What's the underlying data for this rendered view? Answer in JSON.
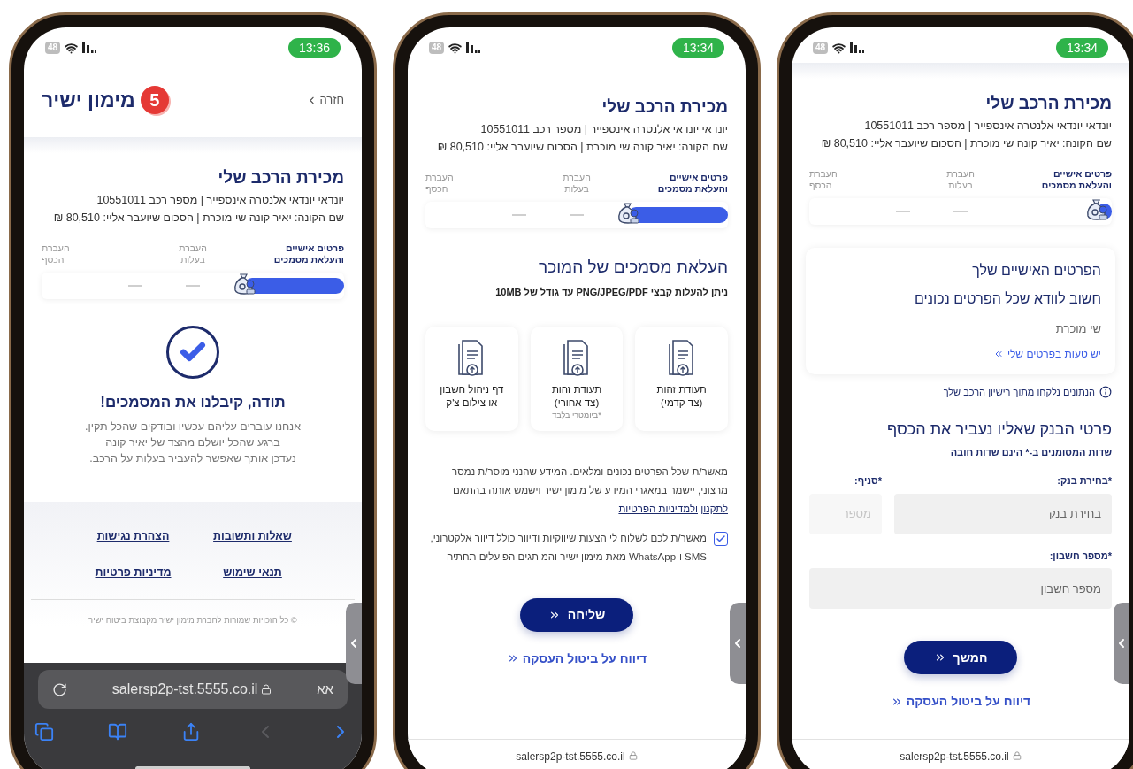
{
  "phones": [
    {
      "status": {
        "battery": "48",
        "time": "13:34"
      },
      "sections": [
        {
          "kind": "band"
        },
        {
          "kind": "summary",
          "title": "מכירת הרכב שלי",
          "lines": [
            "יונדאי יונדאי אלנטרה אינספייר | מספר רכב 10551011",
            "שם הקונה: יאיר קונה שי מוכרת | הסכום שיועבר אליי: 80,510 ₪"
          ]
        },
        {
          "kind": "stepper",
          "level": 0.05,
          "steps": [
            {
              "label": "פרטים אישיים\nוהעלאת מסמכים",
              "selected": true
            },
            {
              "label": "העברת\nבעלות",
              "selected": false
            },
            {
              "label": "העברת\nהכסף",
              "selected": false
            }
          ]
        },
        {
          "kind": "details",
          "heading": "הפרטים האישיים שלך",
          "subheading": "חשוב לוודא שכל הפרטים נכונים",
          "name": "שי מוכרת",
          "link": "יש טעות בפרטים שלי"
        },
        {
          "kind": "info",
          "text": "הנתונים נלקחו מתוך רישיון הרכב שלך"
        },
        {
          "kind": "bank_form",
          "title": "פרטי הבנק שאליו נעביר את הכסף",
          "note": "שדות המסומנים ב-* הינם שדות חובה",
          "rows": [
            {
              "fields": [
                {
                  "kind": "main",
                  "label": "*בחירת בנק:",
                  "placeholder": "בחירת בנק",
                  "disabled": false
                },
                {
                  "kind": "narrow",
                  "label": "*סניף:",
                  "placeholder": "מספר",
                  "disabled": true
                }
              ]
            },
            {
              "fields": [
                {
                  "kind": "main",
                  "label": "*מספר חשבון:",
                  "placeholder": "מספר חשבון",
                  "disabled": false
                }
              ]
            }
          ]
        },
        {
          "kind": "button",
          "label": "המשך"
        },
        {
          "kind": "link",
          "label": "דיווח על ביטול העסקה"
        }
      ],
      "browser": {
        "kind": "compact",
        "url": "salersp2p-tst.5555.co.il"
      }
    },
    {
      "status": {
        "battery": "48",
        "time": "13:34"
      },
      "sections": [
        {
          "kind": "spacer"
        },
        {
          "kind": "summary",
          "title": "מכירת הרכב שלי",
          "lines": [
            "יונדאי יונדאי אלנטרה אינספייר | מספר רכב 10551011",
            "שם הקונה: יאיר קונה שי מוכרת | הסכום שיועבר אליי: 80,510 ₪"
          ]
        },
        {
          "kind": "stepper",
          "level": 0.33,
          "steps": [
            {
              "label": "פרטים אישיים\nוהעלאת מסמכים",
              "selected": true
            },
            {
              "label": "העברת\nבעלות",
              "selected": false
            },
            {
              "label": "העברת\nהכסף",
              "selected": false
            }
          ]
        },
        {
          "kind": "upload",
          "title": "העלאת מסמכים של המוכר",
          "note": "ניתן להעלות קבצי PNG/JPEG/PDF עד גודל של 10MB",
          "cards": [
            {
              "label": "תעודת זהות\n(צד קדמי)"
            },
            {
              "label": "תעודת זהות\n(צד אחורי)",
              "note": "*ביומטרי בלבד"
            },
            {
              "label": "דף ניהול חשבון\nאו צילום צ'ק"
            }
          ]
        },
        {
          "kind": "consent",
          "text": "מאשר/ת שכל הפרטים נכונים ומלאים. המידע שהנני מוסר/ת נמסר מרצוני, יישמר במאגרי המידע של מימון ישיר וישמש אותה בהתאם",
          "links": [
            "לתקנון",
            "ולמדיניות הפרטיות"
          ],
          "checkbox": {
            "checked": true,
            "label": "מאשר/ת לכם לשלוח לי הצעות שיווקיות ודיוור כולל דיוור אלקטרוני, SMS ו-WhatsApp מאת מימון ישיר והמותגים הפועלים תחתיה"
          }
        },
        {
          "kind": "button",
          "label": "שליחה"
        },
        {
          "kind": "link",
          "label": "דיווח על ביטול העסקה"
        }
      ],
      "browser": {
        "kind": "compact",
        "url": "salersp2p-tst.5555.co.il"
      }
    },
    {
      "status": {
        "battery": "48",
        "time": "13:36"
      },
      "sections": [
        {
          "kind": "header",
          "back": "חזרה",
          "logo": {
            "mark": "5",
            "name": "מימון ישיר"
          }
        },
        {
          "kind": "band"
        },
        {
          "kind": "summary",
          "title": "מכירת הרכב שלי",
          "lines": [
            "יונדאי יונדאי אלנטרה אינספייר | מספר רכב 10551011",
            "שם הקונה: יאיר קונה שי מוכרת | הסכום שיועבר אליי: 80,510 ₪"
          ]
        },
        {
          "kind": "stepper",
          "level": 0.33,
          "steps": [
            {
              "label": "פרטים אישיים\nוהעלאת מסמכים",
              "selected": true
            },
            {
              "label": "העברת\nבעלות",
              "selected": false
            },
            {
              "label": "העברת\nהכסף",
              "selected": false
            }
          ]
        },
        {
          "kind": "success",
          "heading": "תודה, קיבלנו את המסמכים!",
          "body": "אנחנו עוברים עליהם עכשיו ובודקים שהכל תקין.\nברגע שהכל יושלם מהצד של יאיר קונה\nנעדכן אותך שאפשר להעביר בעלות על הרכב."
        },
        {
          "kind": "footer",
          "links": [
            "שאלות ותשובות",
            "הצהרת נגישות",
            "תנאי שימוש",
            "מדיניות פרטיות"
          ],
          "copyright": "© כל הזכויות שמורות לחברת מימון ישיר מקבוצת ביטוח ישיר"
        }
      ],
      "browser": {
        "kind": "safari",
        "url": "salersp2p-tst.5555.co.il",
        "text_size": "אא"
      }
    }
  ]
}
